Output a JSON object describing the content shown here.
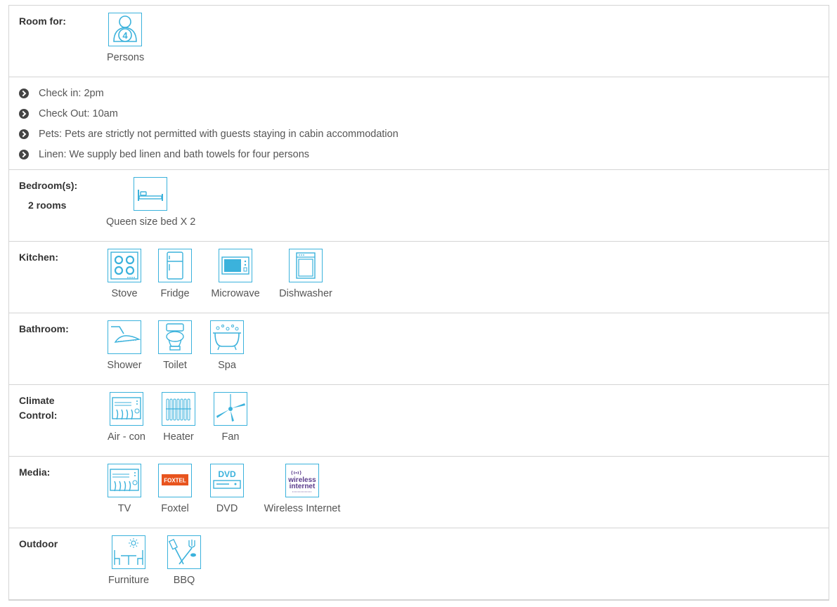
{
  "room_for": {
    "label": "Room for:",
    "persons_count": "4",
    "persons_caption": "Persons"
  },
  "rules": [
    {
      "text": "Check in: 2pm"
    },
    {
      "text": "Check Out: 10am"
    },
    {
      "text": "Pets: Pets are strictly not permitted with guests staying in cabin accommodation"
    },
    {
      "text": "Linen: We supply bed linen and bath towels for four persons"
    }
  ],
  "bedrooms": {
    "label": "Bedroom(s):",
    "count_text": "2 rooms",
    "items": [
      {
        "caption": "Queen size bed X 2",
        "icon": "bed-icon"
      }
    ]
  },
  "kitchen": {
    "label": "Kitchen:",
    "items": [
      {
        "caption": "Stove",
        "icon": "stove-icon"
      },
      {
        "caption": "Fridge",
        "icon": "fridge-icon"
      },
      {
        "caption": "Microwave",
        "icon": "microwave-icon"
      },
      {
        "caption": "Dishwasher",
        "icon": "dishwasher-icon"
      }
    ]
  },
  "bathroom": {
    "label": "Bathroom:",
    "items": [
      {
        "caption": "Shower",
        "icon": "shower-icon"
      },
      {
        "caption": "Toilet",
        "icon": "toilet-icon"
      },
      {
        "caption": "Spa",
        "icon": "spa-icon"
      }
    ]
  },
  "climate": {
    "label_line1": "Climate",
    "label_line2": "Control:",
    "items": [
      {
        "caption": "Air - con",
        "icon": "air-con-icon"
      },
      {
        "caption": "Heater",
        "icon": "heater-icon"
      },
      {
        "caption": "Fan",
        "icon": "fan-icon"
      }
    ]
  },
  "media": {
    "label": "Media:",
    "items": [
      {
        "caption": "TV",
        "icon": "tv-icon"
      },
      {
        "caption": "Foxtel",
        "icon": "foxtel-logo-icon",
        "logo_text": "FOXTEL"
      },
      {
        "caption": "DVD",
        "icon": "dvd-icon",
        "logo_text": "DVD"
      },
      {
        "caption": "Wireless Internet",
        "icon": "wireless-internet-icon",
        "logo_line1": "wireless",
        "logo_line2": "internet"
      }
    ]
  },
  "outdoor": {
    "label": "Outdoor",
    "items": [
      {
        "caption": "Furniture",
        "icon": "outdoor-furniture-icon"
      },
      {
        "caption": "BBQ",
        "icon": "bbq-icon"
      }
    ]
  },
  "colors": {
    "accent": "#3bb2dc",
    "border": "#d4d4d4",
    "foxtel": "#e8541e",
    "wireless": "#5b3c8c"
  }
}
